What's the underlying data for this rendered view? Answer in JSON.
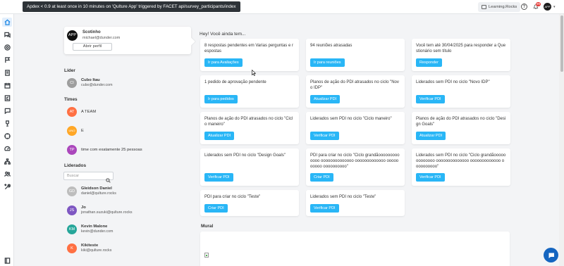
{
  "topbar": {
    "alert": "Apdex < 0.9 at least once in 10 minutes on 'Qulture App' triggered by FACET api/survey_participants/index",
    "brand": "Learning.Rocks",
    "help_icon": "help-circle-icon",
    "notifications_icon": "bell-icon",
    "notifications_count": "99",
    "avatar_initials": "APP"
  },
  "sidebar": {
    "icons": [
      "home-icon",
      "chat-icon",
      "target-icon",
      "flag-icon",
      "document-icon",
      "calendar-icon",
      "checklist-icon",
      "message-icon",
      "trophy-icon",
      "compass-icon",
      "gauge-icon",
      "org-chart-icon",
      "people-icon",
      "tools-icon",
      "book-icon"
    ]
  },
  "profile": {
    "avatar_initials": "APP",
    "name": "Scotinho",
    "email": "michael@dunder.com",
    "open_button": "Abrir perfil"
  },
  "leader": {
    "label": "Líder",
    "initials": "CI",
    "name": "Cubo Itau",
    "email": "cubo@dunder.com"
  },
  "teams": {
    "label": "Times",
    "items": [
      {
        "initials": "AT",
        "name": "A TEAM",
        "color": "#ff7043"
      },
      {
        "initials": "UNO",
        "name": "E",
        "color": "#ffa726"
      },
      {
        "initials": "TP",
        "name": "time com exatamente 25 pessoas",
        "color": "#ab47bc"
      }
    ]
  },
  "led": {
    "label": "Liderados",
    "search_placeholder": "Buscar",
    "items": [
      {
        "initials": "GD",
        "name": "Gleidson Daniel",
        "email": "daniel@qulture.rocks",
        "color": "#bdbdbd"
      },
      {
        "initials": "JS",
        "name": "Jo",
        "email": "jonathan.suzuki@qulture.rocks",
        "color": "#7e57c2"
      },
      {
        "initials": "KM",
        "name": "Kevin Malone",
        "email": "kevin@dunder.com",
        "color": "#26a69a"
      },
      {
        "initials": "K",
        "name": "Kikiteste",
        "email": "kiki@qulture.rocks",
        "color": "#ff7043"
      }
    ]
  },
  "main": {
    "greeting": "Hey! Você ainda tem...",
    "cards": [
      {
        "text": "8 respostas pendentes em Varias perguntas e respostas",
        "button": "Ir para Avaliações"
      },
      {
        "text": "94 reuniões atrasadas",
        "button": "Ir para reuniões"
      },
      {
        "text": "Você tem até 30/04/2025 para responder a Questionário sem título",
        "button": "Responder"
      },
      {
        "text": "1 pedido de aprovação pendente",
        "button": "Ir para pedidos"
      },
      {
        "text": "Planos de ação do PDI atrasados no ciclo \"Novo IDP\"",
        "button": "Atualizar PDI"
      },
      {
        "text": "Liderados sem PDI no ciclo \"Novo IDP\"",
        "button": "Verificar PDI"
      },
      {
        "text": "Planos de ação do PDI atrasados no ciclo \"Ciclo maneiro\"",
        "button": "Atualizar PDI"
      },
      {
        "text": "Liderados sem PDI no ciclo \"Ciclo maneiro\"",
        "button": "Verificar PDI"
      },
      {
        "text": "Planos de ação do PDI atrasados no ciclo \"Design Goals\"",
        "button": "Atualizar PDI"
      },
      {
        "text": "Liderados sem PDI no ciclo \"Design Goals\"",
        "button": "Verificar PDI"
      },
      {
        "text": "PDI para criar no ciclo \"Ciclo grandãooooooooooooo oooooooooooooo ooooooooooooo oooooooooo oooooooooo\"",
        "button": "Criar PDI"
      },
      {
        "text": "Liderados sem PDI no ciclo \"Ciclo grandãooooooooooooo oooooooooooooo ooooooooooooo oooooooooo\"",
        "button": "Verificar PDI"
      },
      {
        "text": "PDI para criar no ciclo \"Teste\"",
        "button": "Criar PDI"
      },
      {
        "text": "Liderados sem PDI no ciclo \"Teste\"",
        "button": "Verificar PDI"
      }
    ],
    "mural_label": "Mural"
  },
  "chat_icon": "chat-bubble-icon"
}
